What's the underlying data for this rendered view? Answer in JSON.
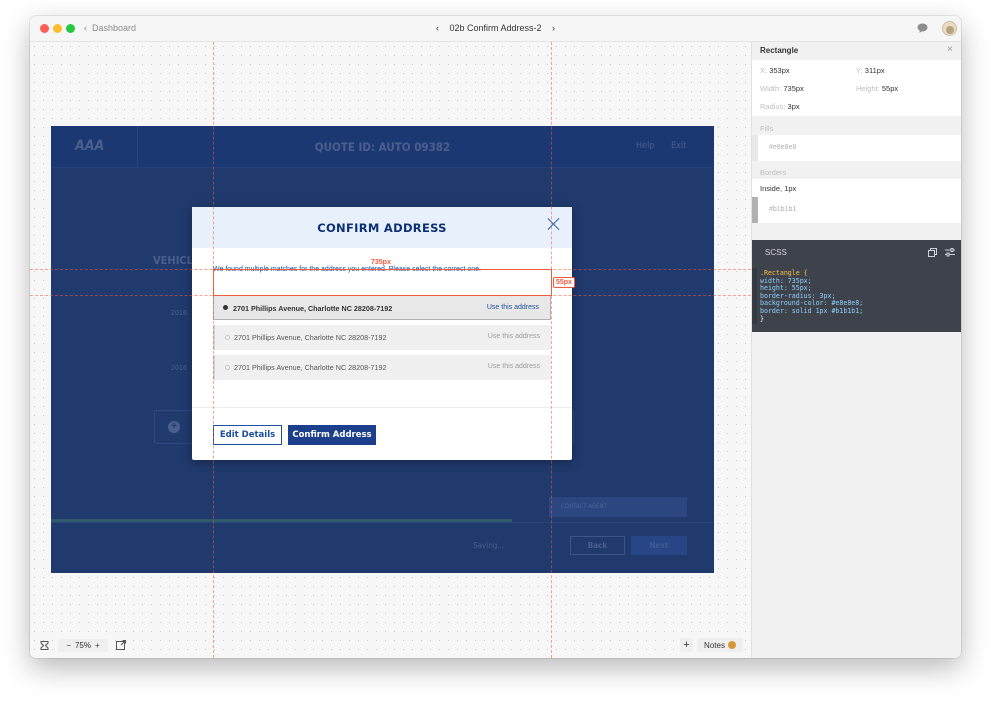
{
  "window": {
    "back_label": "Dashboard",
    "title": "02b Confirm Address-2",
    "nav_prev": "‹",
    "nav_next": "›",
    "back_chevron": "‹"
  },
  "artboard": {
    "logo_text": "AAA",
    "quote_id": "QUOTE ID: AUTO 09382",
    "help": "Help",
    "exit": "Exit",
    "section": "VEHICL",
    "row_a": "2016",
    "row_b": "2016",
    "add_icon": "+",
    "footer_saving": "Saving...",
    "footer_back": "Back",
    "footer_next": "Next",
    "contact_agent": "CONTACT AGENT"
  },
  "modal": {
    "title": "CONFIRM ADDRESS",
    "intro": "We found multiple matches for the address you entered. Please select the correct one.",
    "addresses": [
      {
        "text": "2701 Phillips Avenue, Charlotte NC 28208-7192",
        "action": "Use this address"
      },
      {
        "text": "2701 Phillips Avenue, Charlotte NC 28208-7192",
        "action": "Use this address"
      },
      {
        "text": "2701 Phillips Avenue, Charlotte NC 28208-7192",
        "action": "Use this address"
      }
    ],
    "edit_label": "Edit Details",
    "confirm_label": "Confirm Address"
  },
  "measure": {
    "width_label": "735px",
    "height_label": "55px"
  },
  "inspector": {
    "title": "Rectangle",
    "x_label": "X:",
    "x_value": "353px",
    "y_label": "Y:",
    "y_value": "311px",
    "width_label": "Width:",
    "width_value": "735px",
    "height_label": "Height:",
    "height_value": "55px",
    "radius_label": "Radius:",
    "radius_value": "3px",
    "fills_header": "Fills",
    "fill_color": "#e8e8e8",
    "borders_header": "Borders",
    "border_position": "Inside, 1px",
    "border_color": "#b1b1b1",
    "code_header": "SCSS",
    "code_lines": [
      ".Rectangle {",
      "  width: 735px;",
      "  height: 55px;",
      "  border-radius: 3px;",
      "  background-color: #e8e8e8;",
      "  border: solid 1px #b1b1b1;",
      "}"
    ]
  },
  "bottombar": {
    "zoom": "75%",
    "minus": "−",
    "plus": "+",
    "add": "+",
    "notes": "Notes"
  },
  "colors": {
    "accent": "#1c4fa0",
    "header_navy": "#1c3873",
    "measure_red": "#f25a3c",
    "code_bg": "#3d424b"
  }
}
